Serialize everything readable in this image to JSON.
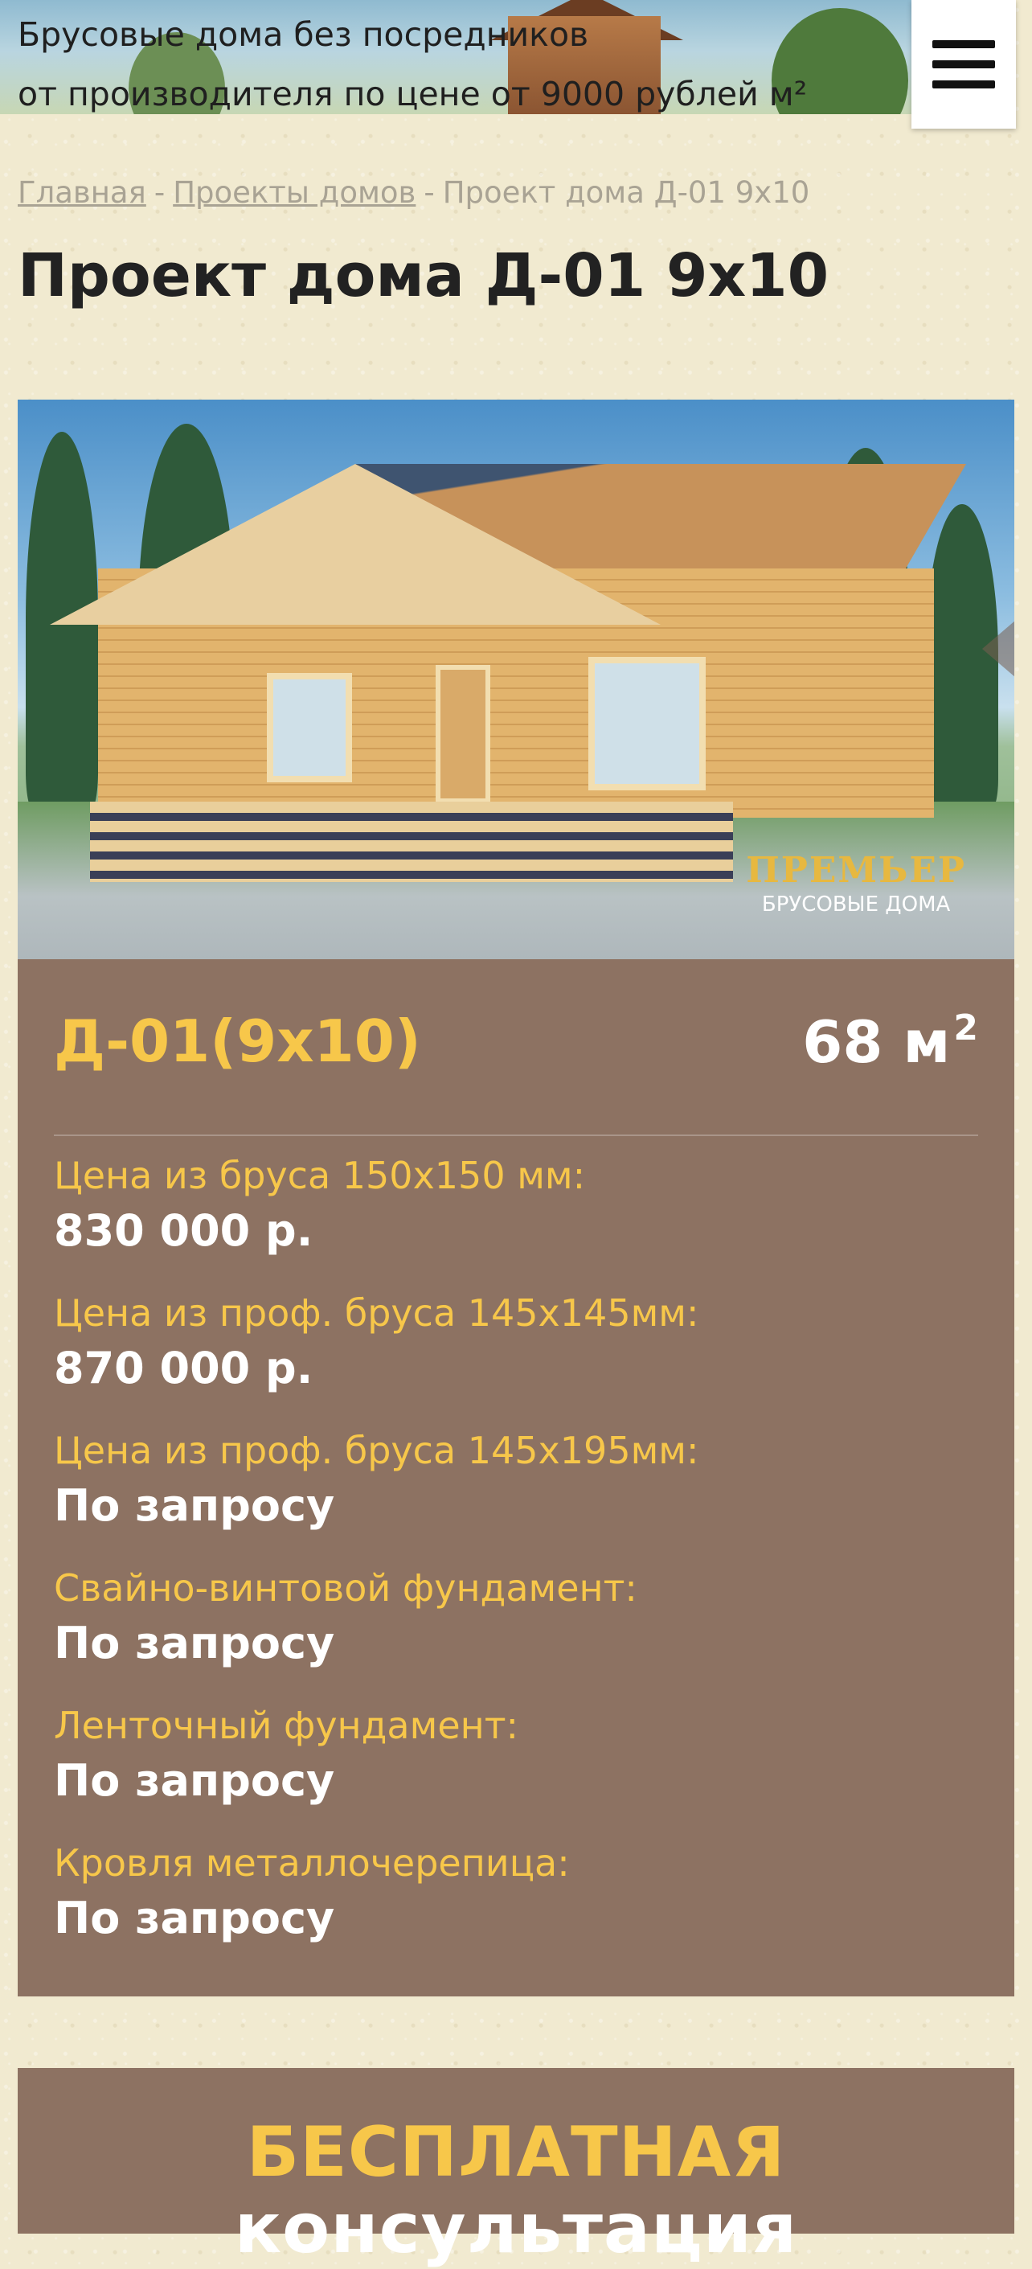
{
  "header": {
    "banner_line1": "Брусовые дома без посредников",
    "banner_line2": "от производителя по цене от 9000 рублей м²",
    "menu_icon": "hamburger-menu-icon"
  },
  "breadcrumb": {
    "home": "Главная",
    "separator": "-",
    "projects": "Проекты домов",
    "current": "Проект дома Д-01 9х10"
  },
  "page_title": "Проект дома Д-01 9х10",
  "gallery": {
    "logo_name": "ПРЕМЬЕР",
    "logo_sub": "БРУСОВЫЕ ДОМА",
    "next_icon": "arrow-right-icon"
  },
  "card": {
    "model": "Д-01(9х10)",
    "area": "68 м",
    "area_sup": "2",
    "prices": [
      {
        "label": "Цена из бруса 150х150 мм:",
        "value": "830 000 р."
      },
      {
        "label": "Цена из проф. бруса 145х145мм:",
        "value": "870 000 р."
      },
      {
        "label": "Цена из проф. бруса 145х195мм:",
        "value": "По запросу"
      },
      {
        "label": "Свайно-винтовой фундамент:",
        "value": "По запросу"
      },
      {
        "label": "Ленточный фундамент:",
        "value": "По запросу"
      },
      {
        "label": "Кровля металлочерепица:",
        "value": "По запросу"
      }
    ]
  },
  "consultation": {
    "title_line1": "БЕСПЛАТНАЯ",
    "title_line2": "консультация"
  },
  "colors": {
    "card_background": "#8d7262",
    "accent_yellow": "#f7c74a",
    "page_background": "#f1ead0"
  }
}
